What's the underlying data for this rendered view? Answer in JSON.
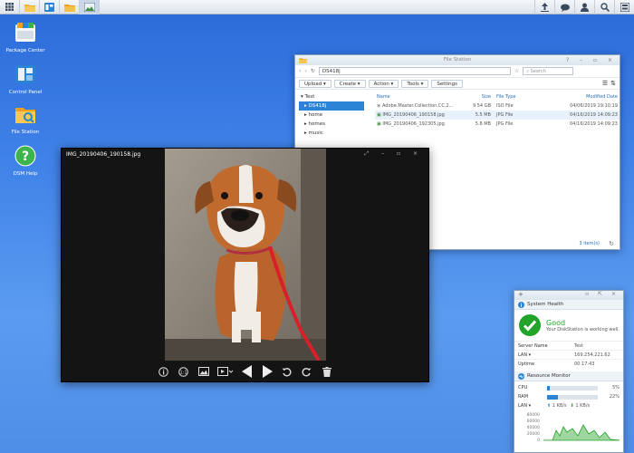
{
  "colors": {
    "accent": "#2b83d6",
    "good": "#22a32a",
    "desktop": "#3f82e8"
  },
  "taskbar": {
    "left_icons": [
      "main-menu-icon",
      "file-station-icon",
      "control-panel-icon",
      "folder-icon",
      "photo-viewer-icon"
    ],
    "right_icons": [
      "upload-queue-icon",
      "notification-icon",
      "user-icon",
      "search-icon",
      "widgets-icon"
    ]
  },
  "desktop": {
    "icons": [
      {
        "label": "Package Center",
        "icon": "package-center-icon"
      },
      {
        "label": "Control Panel",
        "icon": "control-panel-icon"
      },
      {
        "label": "File Station",
        "icon": "file-station-icon"
      },
      {
        "label": "DSM Help",
        "icon": "help-icon"
      }
    ]
  },
  "file_station": {
    "title": "File Station",
    "path": "DS418j",
    "search_placeholder": "Search",
    "toolbar": {
      "upload": "Upload ▾",
      "create": "Create ▾",
      "action": "Action ▾",
      "tools": "Tools ▾",
      "settings": "Settings"
    },
    "tree": {
      "root": "Test",
      "items": [
        "DS418j",
        "home",
        "homes",
        "music"
      ]
    },
    "columns": {
      "name": "Name",
      "size": "Size",
      "type": "File Type",
      "modified": "Modified Date"
    },
    "rows": [
      {
        "name": "Adobe.Master.Collection.CC.2...",
        "size": "9.54 GB",
        "type": "ISO File",
        "modified": "04/06/2019 19:10:19"
      },
      {
        "name": "IMG_20190406_190158.jpg",
        "size": "5.5 MB",
        "type": "JPG File",
        "modified": "04/16/2019 14:09:23"
      },
      {
        "name": "IMG_20190406_192305.jpg",
        "size": "5.8 MB",
        "type": "JPG File",
        "modified": "04/16/2019 14:09:23"
      }
    ],
    "item_count": "3 item(s)"
  },
  "photo_viewer": {
    "title": "IMG_20190406_190158.jpg",
    "controls": [
      "info-icon",
      "zoom-icon",
      "image-icon",
      "slideshow-icon",
      "previous-icon",
      "next-icon",
      "rotate-left-icon",
      "rotate-right-icon",
      "delete-icon"
    ]
  },
  "widget": {
    "system_health": {
      "title": "System Health",
      "status": "Good",
      "message": "Your DiskStation is working well.",
      "server_name_label": "Server Name",
      "server_name": "Test",
      "lan_label": "LAN ▾",
      "lan_value": "169.254.221.62",
      "uptime_label": "Uptime",
      "uptime_value": "00:17:43"
    },
    "resource_monitor": {
      "title": "Resource Monitor",
      "cpu_label": "CPU",
      "cpu_value": "5%",
      "cpu_fraction": 0.05,
      "ram_label": "RAM",
      "ram_value": "22%",
      "ram_fraction": 0.22,
      "lan_label": "LAN ▾",
      "lan_up": "1 KB/s",
      "lan_down": "1 KB/s",
      "chart_ticks": [
        "80000",
        "60000",
        "40000",
        "20000",
        "0"
      ]
    }
  }
}
